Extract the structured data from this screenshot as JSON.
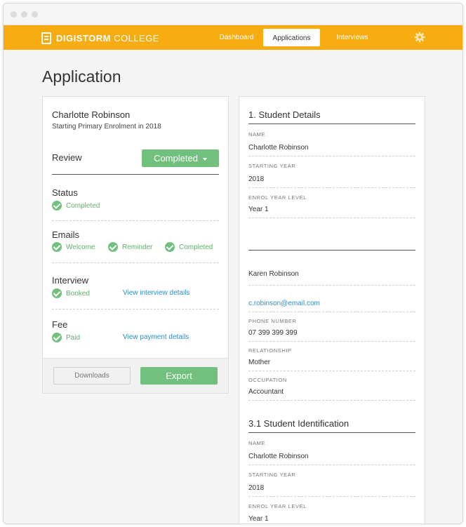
{
  "window": {
    "dots": [
      "close",
      "minimize",
      "zoom"
    ]
  },
  "nav": {
    "brand_bold": "DIGISTORM",
    "brand_light": "COLLEGE",
    "items": [
      {
        "label": "Dashboard",
        "active": false
      },
      {
        "label": "Applications",
        "active": true
      },
      {
        "label": "Interviews",
        "active": false
      }
    ],
    "settings_icon": "gear-icon",
    "bar_color": "#f7ad11"
  },
  "page": {
    "title": "Application"
  },
  "summary": {
    "applicant_name": "Charlotte Robinson",
    "applicant_sub": "Starting Primary Enrolment in 2018",
    "review": {
      "label": "Review",
      "dropdown_value": "Completed"
    },
    "status": {
      "title": "Status",
      "items": [
        "Completed"
      ]
    },
    "emails": {
      "title": "Emails",
      "items": [
        "Welcome",
        "Reminder",
        "Completed"
      ]
    },
    "interview": {
      "title": "Interview",
      "status": "Booked",
      "link": "View interview details"
    },
    "fee": {
      "title": "Fee",
      "status": "Paid",
      "link": "View payment details"
    },
    "downloads_label": "Downloads",
    "export_label": "Export",
    "accent_green": "#72c07e"
  },
  "details": {
    "section1_title": "1. Student Details",
    "fields1": [
      {
        "label": "NAME",
        "value": "Charlotte Robinson"
      },
      {
        "label": "STARTING YEAR",
        "value": "2018"
      },
      {
        "label": "ENROL YEAR LEVEL",
        "value": "Year 1"
      }
    ],
    "contact": {
      "name": "Karen Robinson",
      "email": "c.robinson@email.com",
      "fields": [
        {
          "label": "PHONE NUMBER",
          "value": "07 399 399 399"
        },
        {
          "label": "RELATIONSHIP",
          "value": "Mother"
        },
        {
          "label": "OCCUPATION",
          "value": "Accountant"
        }
      ]
    },
    "section2_title": "3.1 Student Identification",
    "fields2": [
      {
        "label": "NAME",
        "value": "Charlotte Robinson"
      },
      {
        "label": "STARTING YEAR",
        "value": "2018"
      },
      {
        "label": "ENROL YEAR LEVEL",
        "value": "Year 1"
      }
    ]
  }
}
